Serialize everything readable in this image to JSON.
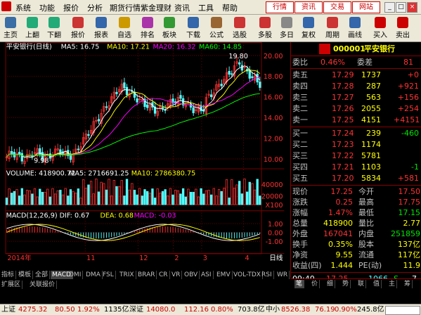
{
  "menu": {
    "items": [
      "系统",
      "功能",
      "报价",
      "分析",
      "期货行情",
      "紫金理财",
      "资讯",
      "工具",
      "帮助"
    ],
    "right_buttons": [
      "行情",
      "资讯",
      "交易",
      "网站"
    ],
    "window_controls": [
      "_",
      "□",
      "×"
    ]
  },
  "toolbar": {
    "buttons": [
      {
        "label": "主页",
        "icon": "home-icon"
      },
      {
        "label": "上翻",
        "icon": "arrow-up-icon"
      },
      {
        "label": "下翻",
        "icon": "arrow-down-icon"
      },
      {
        "label": "报价",
        "icon": "quote-icon"
      },
      {
        "label": "报表",
        "icon": "report-icon"
      },
      {
        "label": "自选",
        "icon": "favorites-icon"
      },
      {
        "label": "排名",
        "icon": "ranking-icon"
      },
      {
        "label": "板块",
        "icon": "sector-icon"
      },
      {
        "label": "下载",
        "icon": "download-icon"
      },
      {
        "label": "公式",
        "icon": "formula-icon"
      },
      {
        "label": "选股",
        "icon": "stock-picker-icon"
      },
      {
        "label": "多股",
        "icon": "multi-stock-icon"
      },
      {
        "label": "多日",
        "icon": "multi-day-icon"
      },
      {
        "label": "复权",
        "icon": "rights-adjust-icon"
      },
      {
        "label": "周期",
        "icon": "period-icon"
      },
      {
        "label": "画线",
        "icon": "draw-line-icon"
      },
      {
        "label": "买入",
        "icon": "buy-icon"
      },
      {
        "label": "卖出",
        "icon": "sell-icon"
      }
    ]
  },
  "chart": {
    "main_header": {
      "title": "平安银行(日线)",
      "ma5": "MA5: 16.75",
      "ma10": "MA10: 17.21",
      "ma20": "MA20: 16.32",
      "ma60": "MA60: 14.85"
    },
    "price_ticks": [
      "20.00",
      "18.00",
      "16.00",
      "14.00",
      "12.00",
      "10.00"
    ],
    "high_annotation": "19.80",
    "low_annotation": "9.98",
    "volume_header": {
      "vol": "VOLUME: 418900.72",
      "ma5": "MA5: 2716691.25",
      "ma10": "MA10: 2786380.75"
    },
    "volume_ticks": [
      "40000",
      "20000"
    ],
    "volume_unit": "X100",
    "macd_header": {
      "name": "MACD(12,26,9)",
      "dif": "DIF: 0.67",
      "dea": "DEA: 0.68",
      "macd": "MACD: -0.03"
    },
    "macd_ticks": [
      "1.00",
      "0.00",
      "-1.00"
    ],
    "date_labels": [
      "2014年",
      "11",
      "12",
      "2",
      "3",
      "4"
    ],
    "period_label": "日线"
  },
  "chart_data": {
    "type": "candlestick",
    "symbol": "000001",
    "name": "平安银行",
    "period": "日线",
    "ylim": [
      9.5,
      20.5
    ],
    "annotations": {
      "high": 19.8,
      "low": 9.98
    },
    "last_ma": {
      "MA5": 16.75,
      "MA10": 17.21,
      "MA20": 16.32,
      "MA60": 14.85
    },
    "volume_last": 418900.72,
    "macd_last": {
      "DIF": 0.67,
      "DEA": 0.68,
      "MACD": -0.03
    }
  },
  "tabs": {
    "row1": [
      "指标",
      "模板",
      "全部",
      "MACD",
      "DMI",
      "DMA",
      "FSL",
      "TRIX",
      "BRAR",
      "CR",
      "VR",
      "OBV",
      "ASI",
      "EMV",
      "VOL-TDX",
      "RSI",
      "WR"
    ],
    "row1_active": "MACD",
    "row2": [
      "扩展区",
      "关联报价"
    ]
  },
  "quote": {
    "badge": "R\n300",
    "code": "000001",
    "name": "平安银行",
    "weibi": {
      "label": "委比",
      "pct": "0.46%",
      "label2": "委差",
      "value": "81"
    },
    "asks": [
      {
        "label": "卖五",
        "price": "17.29",
        "vol": "1737",
        "chg": "+0"
      },
      {
        "label": "卖四",
        "price": "17.28",
        "vol": "287",
        "chg": "+921"
      },
      {
        "label": "卖三",
        "price": "17.27",
        "vol": "563",
        "chg": "+156"
      },
      {
        "label": "卖二",
        "price": "17.26",
        "vol": "2055",
        "chg": "+254"
      },
      {
        "label": "卖一",
        "price": "17.25",
        "vol": "4151",
        "chg": "+4151"
      }
    ],
    "bids": [
      {
        "label": "买一",
        "price": "17.24",
        "vol": "239",
        "chg": "-460"
      },
      {
        "label": "买二",
        "price": "17.23",
        "vol": "1174",
        "chg": ""
      },
      {
        "label": "买三",
        "price": "17.22",
        "vol": "5781",
        "chg": ""
      },
      {
        "label": "买四",
        "price": "17.21",
        "vol": "1103",
        "chg": "-1"
      },
      {
        "label": "买五",
        "price": "17.20",
        "vol": "5834",
        "chg": "+581"
      }
    ],
    "stats": [
      {
        "l1": "现价",
        "v1": "17.25",
        "l2": "今开",
        "v2": "17.50"
      },
      {
        "l1": "涨跌",
        "v1": "0.25",
        "l2": "最高",
        "v2": "17.75"
      },
      {
        "l1": "涨幅",
        "v1": "1.47%",
        "l2": "最低",
        "v2": "17.15"
      },
      {
        "l1": "总量",
        "v1": "418900",
        "l2": "量比",
        "v2": "2.77"
      },
      {
        "l1": "外盘",
        "v1": "167041",
        "l2": "内盘",
        "v2": "251859"
      },
      {
        "l1": "换手",
        "v1": "0.35%",
        "l2": "股本",
        "v2": "137亿"
      },
      {
        "l1": "净资",
        "v1": "9.55",
        "l2": "流通",
        "v2": "117亿"
      },
      {
        "l1": "收益(四)",
        "v1": "1.444",
        "l2": "PE(动)",
        "v2": "11.9"
      }
    ],
    "tick": {
      "time": "09:40",
      "price": "17.25",
      "vol": "1066",
      "flag": "S",
      "num": "7"
    },
    "bottom_tabs": [
      "笔",
      "价",
      "细",
      "势",
      "联",
      "值",
      "主",
      "筹"
    ]
  },
  "status": {
    "sh_label": "上证",
    "sh_val": "4275.32",
    "sh_chg": "80.50",
    "sh_pct": "1.92%",
    "sh_amt": "1135亿",
    "sz_label": "深证",
    "sz_val": "14080.0",
    "sz_chg": "112.16",
    "sz_pct": "0.80%",
    "sz_amt": "703.8亿",
    "zx_label": "中小",
    "zx_val": "8526.38",
    "zx_chg": "76.19",
    "zx_pct": "0.90%",
    "zx_amt": "245.8亿"
  },
  "colors": {
    "up": "#ff3232",
    "down": "#54ffff",
    "ma5": "#ffffff",
    "ma10": "#ffff00",
    "ma20": "#ff00ff",
    "ma60": "#00ff00",
    "grid": "#800000"
  }
}
